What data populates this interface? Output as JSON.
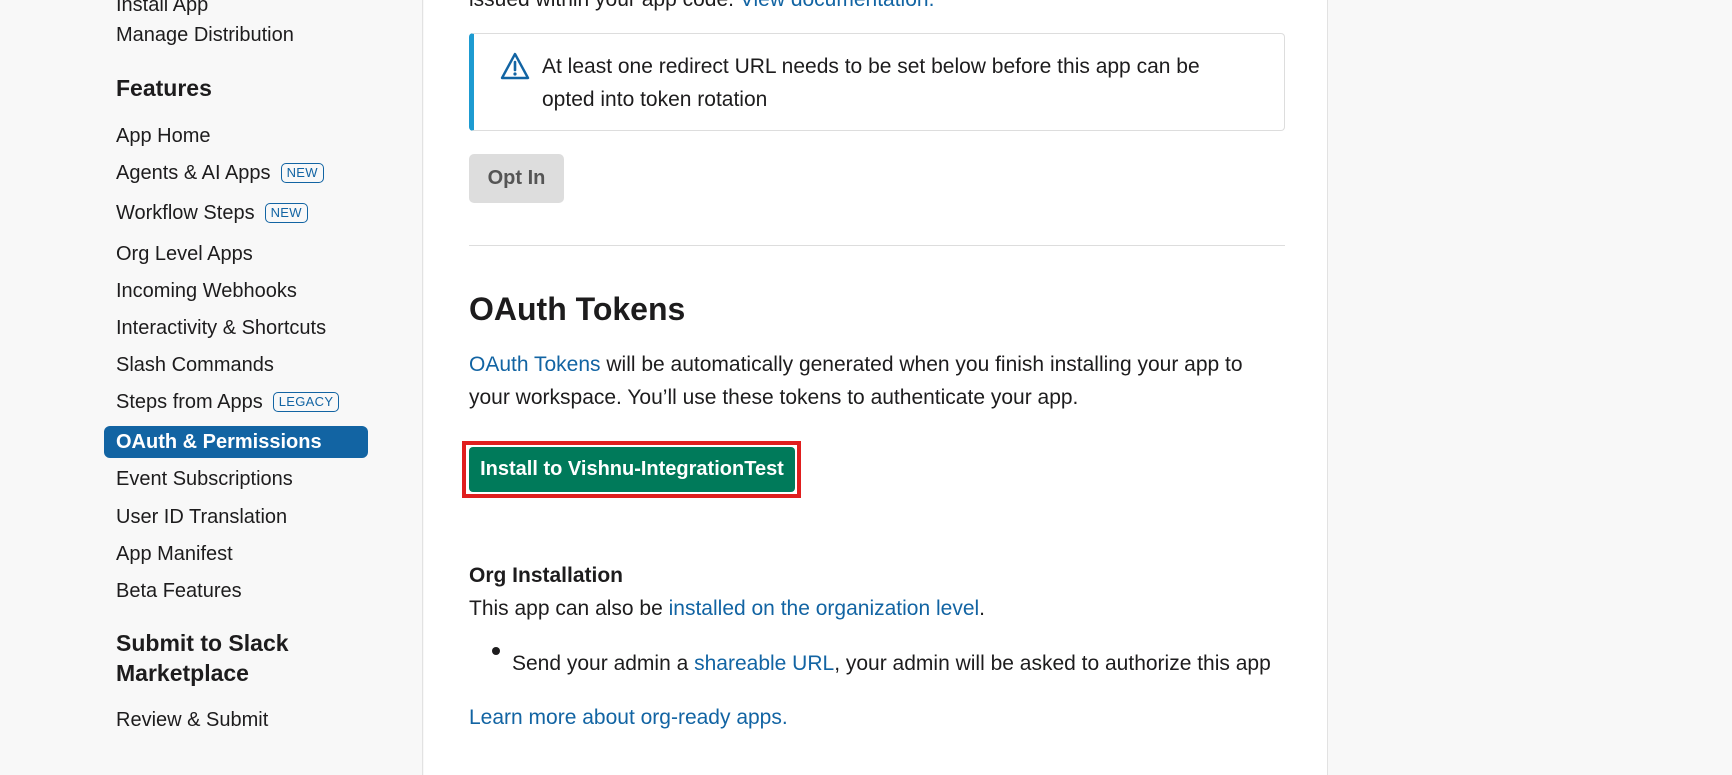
{
  "sidebar": {
    "top_items": [
      {
        "label": "Install App"
      },
      {
        "label": "Manage Distribution"
      }
    ],
    "features_heading": "Features",
    "features": [
      {
        "label": "App Home",
        "badge": ""
      },
      {
        "label": "Agents & AI Apps",
        "badge": "NEW"
      },
      {
        "label": "Workflow Steps",
        "badge": "NEW"
      },
      {
        "label": "Org Level Apps",
        "badge": ""
      },
      {
        "label": "Incoming Webhooks",
        "badge": ""
      },
      {
        "label": "Interactivity & Shortcuts",
        "badge": ""
      },
      {
        "label": "Slash Commands",
        "badge": ""
      },
      {
        "label": "Steps from Apps",
        "badge": "LEGACY"
      },
      {
        "label": "OAuth & Permissions",
        "badge": "",
        "active": true
      },
      {
        "label": "Event Subscriptions",
        "badge": ""
      },
      {
        "label": "User ID Translation",
        "badge": ""
      },
      {
        "label": "App Manifest",
        "badge": ""
      },
      {
        "label": "Beta Features",
        "badge": ""
      }
    ],
    "submit_heading": "Submit to Slack Marketplace",
    "submit_items": [
      {
        "label": "Review & Submit"
      }
    ]
  },
  "main": {
    "top_text": "issued within your app code.",
    "top_link": "View documentation.",
    "alert": {
      "icon": "warning-triangle-icon",
      "text": "At least one redirect URL needs to be set below before this app can be opted into token rotation"
    },
    "opt_in_label": "Opt In",
    "oauth": {
      "title": "OAuth Tokens",
      "desc_link": "OAuth Tokens",
      "desc_rest": " will be automatically generated when you finish installing your app to your workspace. You’ll use these tokens to authenticate your app.",
      "install_label": "Install to Vishnu-IntegrationTest"
    },
    "org": {
      "title": "Org Installation",
      "line_pre": "This app can also be ",
      "line_link": "installed on the organization level",
      "line_post": ".",
      "bullet_pre": "Send your admin a ",
      "bullet_link": "shareable URL",
      "bullet_post": ", your admin will be asked to authorize this app",
      "learn_more": "Learn more about org-ready apps."
    }
  },
  "colors": {
    "accent": "#1264a3",
    "install_green": "#007a5a",
    "highlight_red": "#e01e1e",
    "alert_border": "#1d9bd1"
  }
}
